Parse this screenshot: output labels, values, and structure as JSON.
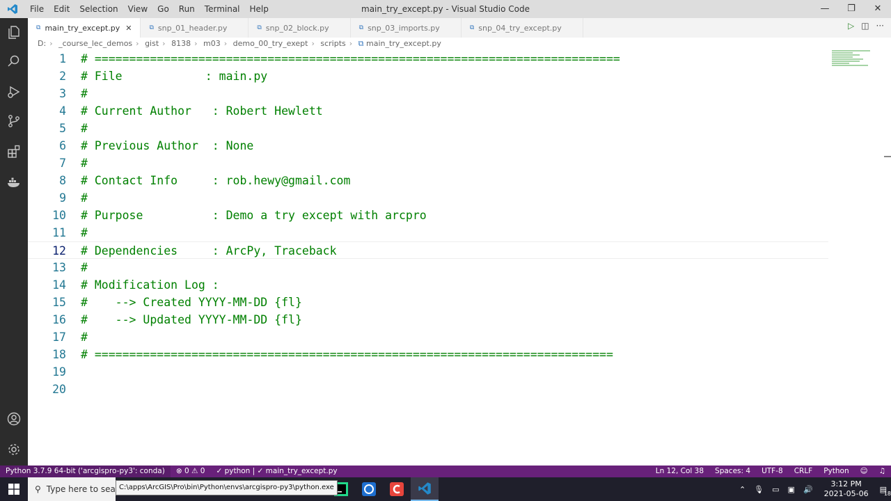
{
  "window": {
    "title": "main_try_except.py - Visual Studio Code",
    "menu": [
      "File",
      "Edit",
      "Selection",
      "View",
      "Go",
      "Run",
      "Terminal",
      "Help"
    ],
    "controls": {
      "minimize": "—",
      "restore": "❐",
      "close": "✕"
    }
  },
  "tabs": [
    {
      "label": "main_try_except.py",
      "active": true
    },
    {
      "label": "snp_01_header.py",
      "active": false
    },
    {
      "label": "snp_02_block.py",
      "active": false
    },
    {
      "label": "snp_03_imports.py",
      "active": false
    },
    {
      "label": "snp_04_try_except.py",
      "active": false
    }
  ],
  "breadcrumb": [
    "D:",
    "_course_lec_demos",
    "gist",
    "8138",
    "m03",
    "demo_00_try_exept",
    "scripts",
    "main_try_except.py"
  ],
  "editor": {
    "current_line": 12,
    "lines": [
      {
        "n": "1",
        "text": "# ============================================================================"
      },
      {
        "n": "2",
        "text": "# File            : main.py"
      },
      {
        "n": "3",
        "text": "#"
      },
      {
        "n": "4",
        "text": "# Current Author   : Robert Hewlett"
      },
      {
        "n": "5",
        "text": "#"
      },
      {
        "n": "6",
        "text": "# Previous Author  : None"
      },
      {
        "n": "7",
        "text": "#"
      },
      {
        "n": "8",
        "text": "# Contact Info     : rob.hewy@gmail.com"
      },
      {
        "n": "9",
        "text": "#"
      },
      {
        "n": "10",
        "text": "# Purpose          : Demo a try except with arcpro"
      },
      {
        "n": "11",
        "text": "#"
      },
      {
        "n": "12",
        "text": "# Dependencies     : ArcPy, Traceback"
      },
      {
        "n": "13",
        "text": "#"
      },
      {
        "n": "14",
        "text": "# Modification Log :"
      },
      {
        "n": "15",
        "text": "#    --> Created YYYY-MM-DD {fl}"
      },
      {
        "n": "16",
        "text": "#    --> Updated YYYY-MM-DD {fl}"
      },
      {
        "n": "17",
        "text": "#"
      },
      {
        "n": "18",
        "text": "# ==========================================================================="
      },
      {
        "n": "19",
        "text": ""
      },
      {
        "n": "20",
        "text": ""
      }
    ]
  },
  "statusbar": {
    "interpreter": "Python 3.7.9 64-bit ('arcgispro-py3': conda)",
    "problems": "⊗ 0 ⚠ 0",
    "python_check": "✓ python | ✓ main_try_except.py",
    "position": "Ln 12, Col 38",
    "spaces": "Spaces: 4",
    "encoding": "UTF-8",
    "eol": "CRLF",
    "language": "Python"
  },
  "tooltip": "C:\\apps\\ArcGIS\\Pro\\bin\\Python\\envs\\arcgispro-py3\\python.exe",
  "taskbar": {
    "search_placeholder": "Type here to search",
    "time": "3:12 PM",
    "date": "2021-05-06",
    "notifications": "18"
  },
  "colors": {
    "statusbar": "#68217a",
    "comment": "#008000",
    "line_number": "#237893",
    "activitybar": "#2c2c2c"
  }
}
